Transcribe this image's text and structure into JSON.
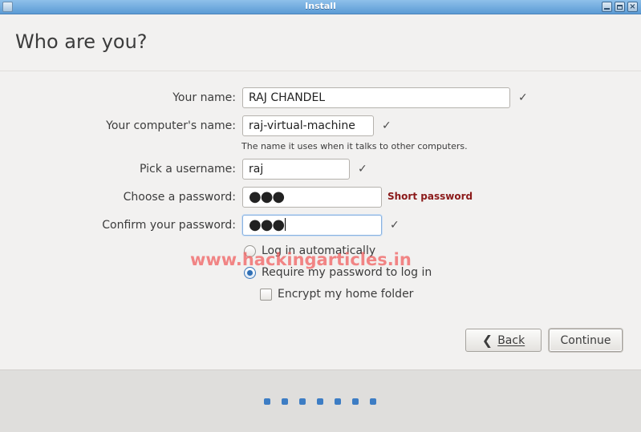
{
  "window": {
    "title": "Install"
  },
  "header": {
    "title": "Who are you?"
  },
  "form": {
    "name_label": "Your name:",
    "name_value": "RAJ CHANDEL",
    "computer_label": "Your computer's name:",
    "computer_value": "raj-virtual-machine",
    "computer_hint": "The name it uses when it talks to other computers.",
    "username_label": "Pick a username:",
    "username_value": "raj",
    "password_label": "Choose a password:",
    "password_value": "●●●",
    "password_warning": "Short password",
    "confirm_label": "Confirm your password:",
    "confirm_value": "●●●",
    "check_mark": "✓"
  },
  "login_options": {
    "auto_label": "Log in automatically",
    "require_label": "Require my password to log in",
    "selected": "require",
    "encrypt_label": "Encrypt my home folder",
    "encrypt_checked": false
  },
  "watermark": "www.hackingarticles.in",
  "buttons": {
    "back_label": "Back",
    "continue_label": "Continue"
  },
  "progress": {
    "total_steps": 7
  },
  "colors": {
    "accent": "#3d7dc4",
    "warning": "#8b1a1a",
    "titlebar": "#5b9bd5"
  }
}
